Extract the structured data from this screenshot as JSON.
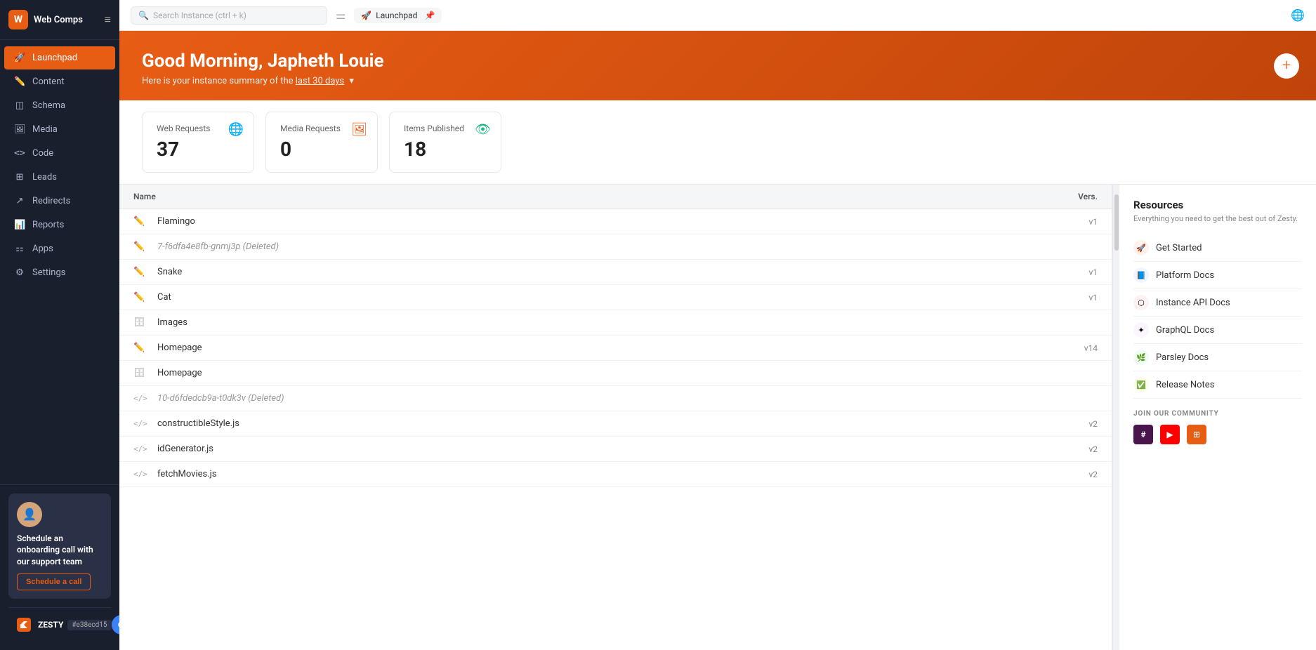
{
  "sidebar": {
    "logo_letter": "W",
    "logo_text": "Web Comps",
    "nav_items": [
      {
        "id": "launchpad",
        "label": "Launchpad",
        "icon": "🚀",
        "active": true
      },
      {
        "id": "content",
        "label": "Content",
        "icon": "✏️",
        "active": false
      },
      {
        "id": "schema",
        "label": "Schema",
        "icon": "◫",
        "active": false
      },
      {
        "id": "media",
        "label": "Media",
        "icon": "🖼",
        "active": false
      },
      {
        "id": "code",
        "label": "Code",
        "icon": "<>",
        "active": false
      },
      {
        "id": "leads",
        "label": "Leads",
        "icon": "⊞",
        "active": false
      },
      {
        "id": "redirects",
        "label": "Redirects",
        "icon": "↗",
        "active": false
      },
      {
        "id": "reports",
        "label": "Reports",
        "icon": "📊",
        "active": false
      },
      {
        "id": "apps",
        "label": "Apps",
        "icon": "⚏",
        "active": false
      },
      {
        "id": "settings",
        "label": "Settings",
        "icon": "⚙",
        "active": false
      }
    ],
    "onboarding": {
      "title": "Schedule an onboarding call with our support team",
      "button_label": "Schedule a call"
    },
    "footer": {
      "hash": "#e38ecd15"
    }
  },
  "topbar": {
    "search_placeholder": "Search Instance (ctrl + k)",
    "active_tab": "Launchpad",
    "pin_label": "Pin"
  },
  "banner": {
    "greeting": "Good Morning, Japheth Louie",
    "subtitle": "Here is your instance summary of the",
    "period_link": "last 30 days",
    "plus_button": "+"
  },
  "stats": [
    {
      "label": "Web Requests",
      "value": "37",
      "icon": "🌐",
      "icon_color": "#3b82f6"
    },
    {
      "label": "Media Requests",
      "value": "0",
      "icon": "🖼",
      "icon_color": "#e85d14"
    },
    {
      "label": "Items Published",
      "value": "18",
      "icon": "👁",
      "icon_color": "#10b981"
    }
  ],
  "table": {
    "col_name": "Name",
    "col_vers": "Vers.",
    "rows": [
      {
        "id": 1,
        "name": "Flamingo",
        "version": "v1",
        "deleted": false,
        "type": "edit"
      },
      {
        "id": 2,
        "name": "7-f6dfa4e8fb-gnmj3p (Deleted)",
        "version": "",
        "deleted": true,
        "type": "edit"
      },
      {
        "id": 3,
        "name": "Snake",
        "version": "v1",
        "deleted": false,
        "type": "edit"
      },
      {
        "id": 4,
        "name": "Cat",
        "version": "v1",
        "deleted": false,
        "type": "edit"
      },
      {
        "id": 5,
        "name": "Images",
        "version": "",
        "deleted": false,
        "type": "db"
      },
      {
        "id": 6,
        "name": "Homepage",
        "version": "v14",
        "deleted": false,
        "type": "edit"
      },
      {
        "id": 7,
        "name": "Homepage",
        "version": "",
        "deleted": false,
        "type": "db"
      },
      {
        "id": 8,
        "name": "10-d6fdedcb9a-t0dk3v (Deleted)",
        "version": "",
        "deleted": true,
        "type": "code"
      },
      {
        "id": 9,
        "name": "constructibleStyle.js",
        "version": "v2",
        "deleted": false,
        "type": "code"
      },
      {
        "id": 10,
        "name": "idGenerator.js",
        "version": "v2",
        "deleted": false,
        "type": "code"
      },
      {
        "id": 11,
        "name": "fetchMovies.js",
        "version": "v2",
        "deleted": false,
        "type": "code"
      }
    ]
  },
  "resources": {
    "title": "Resources",
    "subtitle": "Everything you need to get the best out of Zesty.",
    "items": [
      {
        "label": "Get Started",
        "color": "#e85d14",
        "icon": "🚀"
      },
      {
        "label": "Platform Docs",
        "color": "#3b82f6",
        "icon": "📘"
      },
      {
        "label": "Instance API Docs",
        "color": "#ef4444",
        "icon": "⬡"
      },
      {
        "label": "GraphQL Docs",
        "color": "#a855f7",
        "icon": "✦"
      },
      {
        "label": "Parsley Docs",
        "color": "#22c55e",
        "icon": "🌿"
      },
      {
        "label": "Release Notes",
        "color": "#f59e0b",
        "icon": "✅"
      }
    ],
    "community": {
      "title": "JOIN OUR COMMUNITY",
      "icons": [
        {
          "name": "slack",
          "color": "#4a154b",
          "symbol": "#"
        },
        {
          "name": "youtube",
          "color": "#ff0000",
          "symbol": "▶"
        },
        {
          "name": "table",
          "color": "#e85d14",
          "symbol": "⊞"
        }
      ]
    }
  }
}
